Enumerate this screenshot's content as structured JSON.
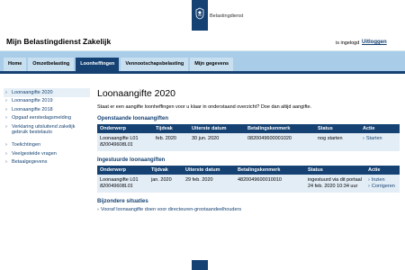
{
  "logo": {
    "text": "Belastingdienst"
  },
  "header": {
    "title": "Mijn Belastingdienst Zakelijk",
    "login_status": "is ingelogd",
    "logout_label": "Uitloggen"
  },
  "nav": {
    "tabs": [
      {
        "label": "Home",
        "active": false
      },
      {
        "label": "Omzetbelasting",
        "active": false
      },
      {
        "label": "Loonheffingen",
        "active": true
      },
      {
        "label": "Vennootschapsbelasting",
        "active": false
      },
      {
        "label": "Mijn gegevens",
        "active": false
      }
    ]
  },
  "sidebar": {
    "items": [
      {
        "label": "Loonaangifte 2020",
        "active": true
      },
      {
        "label": "Loonaangifte 2019",
        "active": false
      },
      {
        "label": "Loonaangifte 2018",
        "active": false
      },
      {
        "label": "Opgaaf eerstedagsmelding",
        "active": false
      },
      {
        "label": "Verklaring uitsluitend zakelijk gebruik bestelauto",
        "active": false
      },
      {
        "label": "Toelichtingen",
        "active": false
      },
      {
        "label": "Veelgestelde vragen",
        "active": false
      },
      {
        "label": "Betaalgegevens",
        "active": false
      }
    ]
  },
  "main": {
    "title": "Loonaangifte 2020",
    "intro": "Staat er een aangifte loonheffingen voor u klaar in onderstaand overzicht? Doe dan altijd aangifte.",
    "open_section": {
      "heading": "Openstaande loonaangiften",
      "columns": [
        "Onderwerp",
        "Tijdvak",
        "Uiterste datum",
        "Betalingskenmerk",
        "Status",
        "Actie"
      ],
      "row": {
        "subject": "Loonaangifte L01",
        "number": "820049608L01",
        "period": "feb. 2020",
        "deadline": "30 jun. 2020",
        "reference": "0820049600001020",
        "status": "nog starten",
        "action": "Starten"
      }
    },
    "submitted_section": {
      "heading": "Ingestuurde loonaangiften",
      "columns": [
        "Onderwerp",
        "Tijdvak",
        "Uiterste datum",
        "Betalingskenmerk",
        "Status",
        "Actie"
      ],
      "row": {
        "subject": "Loonaangifte L01",
        "number": "820049608L01",
        "period": "jan. 2020",
        "deadline": "29 feb. 2020",
        "reference": "4820049600010010",
        "status_line1": "ingestuurd via dit portaal",
        "status_line2": "24 feb. 2020 10:34 uur",
        "action1": "Inzien",
        "action2": "Corrigeren"
      }
    },
    "special": {
      "heading": "Bijzondere situaties",
      "link": "Vooraf loonaangifte doen voor directeuren-grootaandeelhouders"
    }
  },
  "colors": {
    "brand": "#154273",
    "nav_light": "#a9cde8",
    "row_bg": "#e3edf6"
  }
}
